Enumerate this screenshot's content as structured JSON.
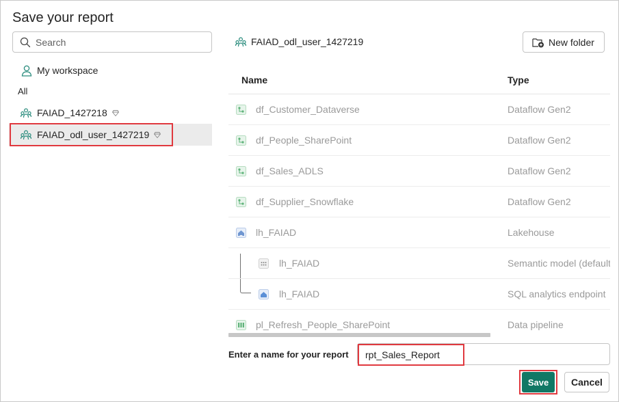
{
  "dialog": {
    "title": "Save your report"
  },
  "sidebar": {
    "search_placeholder": "Search",
    "my_workspace": "My workspace",
    "section_label": "All",
    "workspaces": [
      {
        "label": "FAIAD_1427218",
        "selected": false
      },
      {
        "label": "FAIAD_odl_user_1427219",
        "selected": true
      }
    ]
  },
  "main": {
    "breadcrumb": "FAIAD_odl_user_1427219",
    "new_folder_label": "New folder",
    "columns": {
      "name": "Name",
      "type": "Type"
    },
    "items": [
      {
        "name": "df_Customer_Dataverse",
        "type": "Dataflow Gen2",
        "icon": "dataflow-icon"
      },
      {
        "name": "df_People_SharePoint",
        "type": "Dataflow Gen2",
        "icon": "dataflow-icon"
      },
      {
        "name": "df_Sales_ADLS",
        "type": "Dataflow Gen2",
        "icon": "dataflow-icon"
      },
      {
        "name": "df_Supplier_Snowflake",
        "type": "Dataflow Gen2",
        "icon": "dataflow-icon"
      },
      {
        "name": "lh_FAIAD",
        "type": "Lakehouse",
        "icon": "lakehouse-icon"
      },
      {
        "name": "lh_FAIAD",
        "type": "Semantic model (default)",
        "icon": "semantic-model-icon",
        "child": true
      },
      {
        "name": "lh_FAIAD",
        "type": "SQL analytics endpoint",
        "icon": "sql-endpoint-icon",
        "child": true
      },
      {
        "name": "pl_Refresh_People_SharePoint",
        "type": "Data pipeline",
        "icon": "pipeline-icon"
      }
    ]
  },
  "footer": {
    "name_label": "Enter a name for your report",
    "name_value": "rpt_Sales_Report",
    "save_label": "Save",
    "cancel_label": "Cancel"
  },
  "colors": {
    "accent": "#117865",
    "highlight": "#e0383e",
    "workspace_icon": "#2a8c7d"
  }
}
